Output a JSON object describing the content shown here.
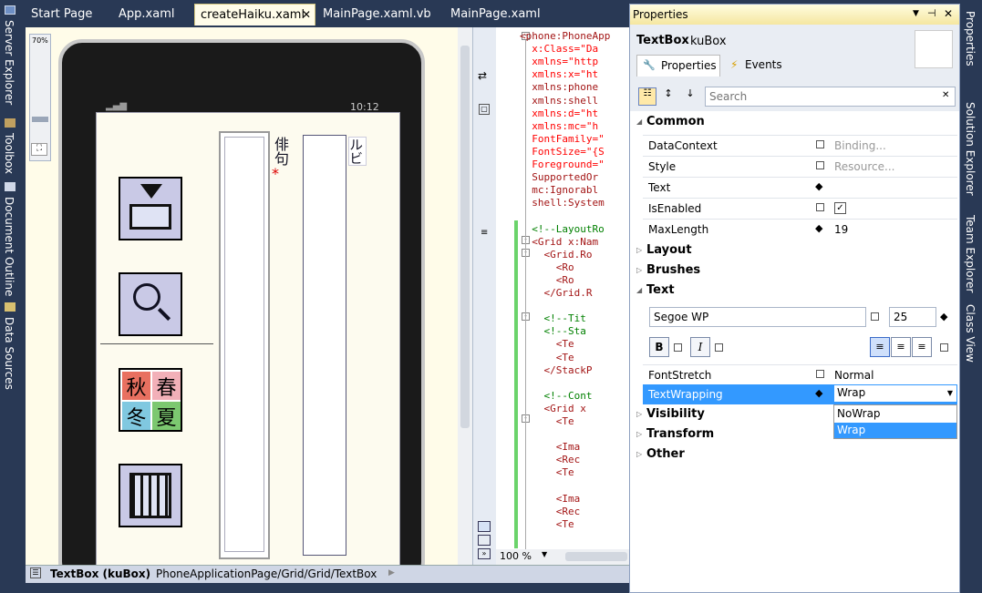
{
  "left_tabs": [
    "Server Explorer",
    "Toolbox",
    "Document Outline",
    "Data Sources"
  ],
  "right_tabs": [
    "Properties",
    "Solution Explorer",
    "Team Explorer",
    "Class View"
  ],
  "doc_tabs": [
    "Start Page",
    "App.xaml",
    "createHaiku.xaml",
    "MainPage.xaml.vb",
    "MainPage.xaml"
  ],
  "zoom_label": "70%",
  "phone": {
    "time": "10:12",
    "haiku_label": "俳句",
    "haiku_star": "*",
    "ruby_label": "ルビ",
    "season_chars": [
      "秋",
      "春",
      "冬",
      "夏"
    ]
  },
  "code_zoom": "100 %",
  "code_lines": [
    "<phone:PhoneApp",
    "  x:Class=\"Da",
    "  xmlns=\"http",
    "  xmlns:x=\"ht",
    "  xmlns:phone",
    "  xmlns:shell",
    "  xmlns:d=\"ht",
    "  xmlns:mc=\"h",
    "  FontFamily=\"",
    "  FontSize=\"{S",
    "  Foreground=\"",
    "  SupportedOr",
    "  mc:Ignorabl",
    "  shell:System",
    "",
    "  <!--LayoutRo",
    "  <Grid x:Nam",
    "    <Grid.Ro",
    "      <Ro",
    "      <Ro",
    "    </Grid.R",
    "",
    "    <!--Tit",
    "    <!--Sta",
    "      <Te",
    "      <Te",
    "    </StackP",
    "",
    "    <!--Cont",
    "    <Grid x",
    "      <Te",
    "",
    "      <Ima",
    "      <Rec",
    "      <Te",
    "",
    "      <Ima",
    "      <Rec",
    "      <Te"
  ],
  "statusbar": {
    "element": "TextBox (kuBox)",
    "path": "PhoneApplicationPage/Grid/Grid/TextBox"
  },
  "properties": {
    "title": "Properties",
    "type": "TextBox",
    "name": "kuBox",
    "tab_properties": "Properties",
    "tab_events": "Events",
    "search_placeholder": "Search",
    "common": "Common",
    "rows": [
      {
        "label": "DataContext",
        "value": "Binding..."
      },
      {
        "label": "Style",
        "value": "Resource..."
      },
      {
        "label": "Text",
        "value": ""
      },
      {
        "label": "IsEnabled",
        "value": "✓"
      },
      {
        "label": "MaxLength",
        "value": "19"
      }
    ],
    "layout": "Layout",
    "brushes": "Brushes",
    "text_section": "Text",
    "font_family": "Segoe WP",
    "font_size": "25",
    "bold": "B",
    "italic": "I",
    "font_stretch_label": "FontStretch",
    "font_stretch_value": "Normal",
    "text_wrapping_label": "TextWrapping",
    "text_wrapping_value": "Wrap",
    "dropdown_options": [
      "NoWrap",
      "Wrap"
    ],
    "visibility": "Visibility",
    "transform": "Transform",
    "other": "Other"
  }
}
